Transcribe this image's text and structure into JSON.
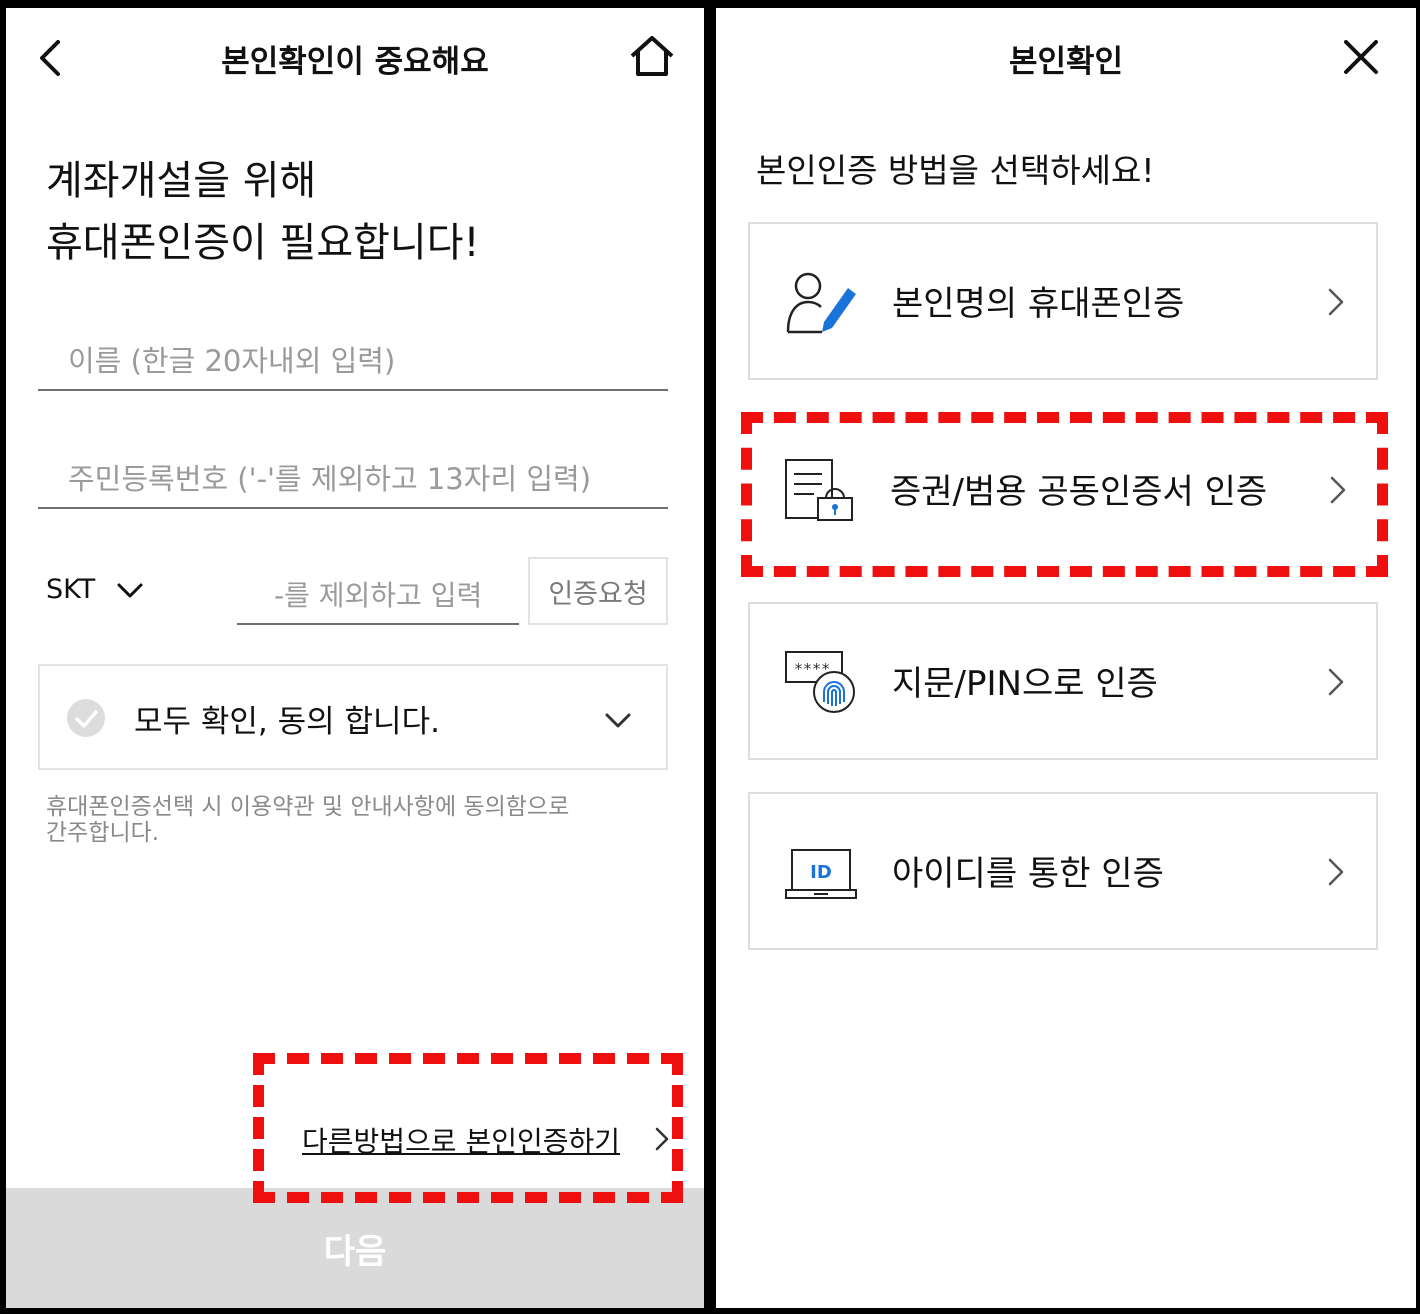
{
  "left": {
    "header": {
      "title": "본인확인이 중요해요",
      "back_icon": "chevron-left-icon",
      "home_icon": "home-icon"
    },
    "headline": {
      "line1": "계좌개설을 위해",
      "line2": "휴대폰인증이 필요합니다!"
    },
    "name_field": {
      "placeholder": "이름 (한글 20자내외 입력)"
    },
    "rrn_field": {
      "placeholder": "주민등록번호 ('-'를 제외하고 13자리 입력)"
    },
    "carrier": {
      "selected": "SKT"
    },
    "phone_field": {
      "placeholder": "-를 제외하고 입력"
    },
    "request_button": "인증요청",
    "agree": {
      "label": "모두 확인, 동의 합니다."
    },
    "notice": {
      "line1": "휴대폰인증선택 시 이용약관 및 안내사항에 동의함으로",
      "line2": "간주합니다."
    },
    "other_method_link": "다른방법으로 본인인증하기",
    "next_button": "다음"
  },
  "right": {
    "header": {
      "title": "본인확인",
      "close_icon": "close-icon"
    },
    "prompt": "본인인증 방법을 선택하세요!",
    "options": [
      {
        "label": "본인명의 휴대폰인증",
        "icon": "user-edit-icon"
      },
      {
        "label": "증권/범용 공동인증서 인증",
        "icon": "certificate-lock-icon"
      },
      {
        "label": "지문/PIN으로 인증",
        "icon": "fingerprint-pin-icon",
        "mask": "****"
      },
      {
        "label": "아이디를 통한 인증",
        "icon": "id-laptop-icon",
        "badge": "ID"
      }
    ]
  },
  "colors": {
    "highlight": "#ee0f0f",
    "accent_blue": "#1a73d9"
  }
}
